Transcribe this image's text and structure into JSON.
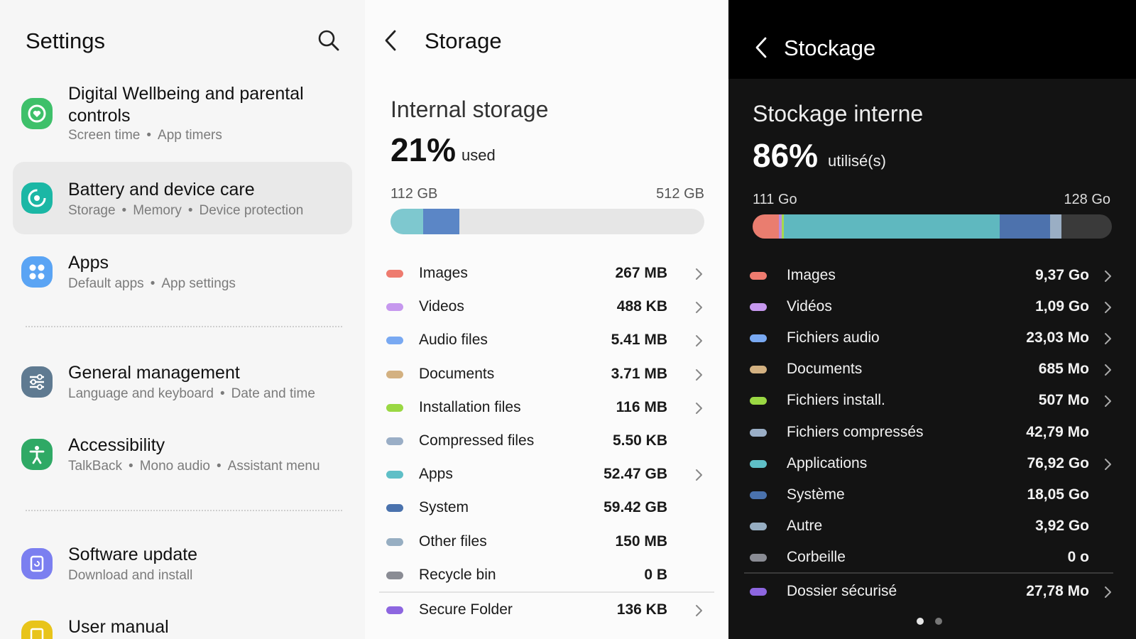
{
  "settings": {
    "title": "Settings",
    "items": [
      {
        "title": "Digital Wellbeing and parental controls",
        "sub": [
          "Screen time",
          "App timers"
        ]
      },
      {
        "title": "Battery and device care",
        "sub": [
          "Storage",
          "Memory",
          "Device protection"
        ]
      },
      {
        "title": "Apps",
        "sub": [
          "Default apps",
          "App settings"
        ]
      },
      {
        "title": "General management",
        "sub": [
          "Language and keyboard",
          "Date and time"
        ]
      },
      {
        "title": "Accessibility",
        "sub": [
          "TalkBack",
          "Mono audio",
          "Assistant menu"
        ]
      },
      {
        "title": "Software update",
        "sub": [
          "Download and install"
        ]
      },
      {
        "title": "User manual",
        "sub": []
      }
    ],
    "colors": {
      "wellbeing": "#3ec06a",
      "battery": "#1bb7a5",
      "apps": "#5aa4f4",
      "general": "#5f7a91",
      "accessibility": "#2fa965",
      "update": "#7b7ff0",
      "manual": "#e8c41a"
    }
  },
  "storage_en": {
    "title": "Storage",
    "heading": "Internal storage",
    "percent": "21%",
    "used_label": "used",
    "used_amount": "112 GB",
    "total": "512 GB",
    "segments": [
      {
        "color": "#7ec8cf",
        "fraction": 0.105
      },
      {
        "color": "#5b86c6",
        "fraction": 0.115
      }
    ],
    "items": [
      {
        "label": "Images",
        "value": "267 MB",
        "color": "#ee7b6f",
        "chevron": true
      },
      {
        "label": "Videos",
        "value": "488 KB",
        "color": "#c698ee",
        "chevron": true
      },
      {
        "label": "Audio files",
        "value": "5.41 MB",
        "color": "#79a9f2",
        "chevron": true
      },
      {
        "label": "Documents",
        "value": "3.71 MB",
        "color": "#d3b181",
        "chevron": true
      },
      {
        "label": "Installation files",
        "value": "116 MB",
        "color": "#9ad843",
        "chevron": true
      },
      {
        "label": "Compressed files",
        "value": "5.50 KB",
        "color": "#9aaec6",
        "chevron": false
      },
      {
        "label": "Apps",
        "value": "52.47 GB",
        "color": "#5fbfc7",
        "chevron": true
      },
      {
        "label": "System",
        "value": "59.42 GB",
        "color": "#4a72ad",
        "chevron": false
      },
      {
        "label": "Other files",
        "value": "150 MB",
        "color": "#97aec2",
        "chevron": false
      },
      {
        "label": "Recycle bin",
        "value": "0 B",
        "color": "#8a8c94",
        "chevron": false
      },
      {
        "label": "Secure Folder",
        "value": "136 KB",
        "color": "#8d66e0",
        "chevron": true
      }
    ]
  },
  "storage_fr": {
    "title": "Stockage",
    "heading": "Stockage interne",
    "percent": "86%",
    "used_label": "utilisé(s)",
    "used_amount": "111 Go",
    "total": "128 Go",
    "segments": [
      {
        "color": "#ea7d6f",
        "fraction": 0.073
      },
      {
        "color": "#b88de0",
        "fraction": 0.009
      },
      {
        "color": "#a7d84e",
        "fraction": 0.004
      },
      {
        "color": "#5fb8bf",
        "fraction": 0.601
      },
      {
        "color": "#4d72ad",
        "fraction": 0.141
      },
      {
        "color": "#9aaec4",
        "fraction": 0.031
      }
    ],
    "items": [
      {
        "label": "Images",
        "value": "9,37 Go",
        "color": "#ee7b6f",
        "chevron": true
      },
      {
        "label": "Vidéos",
        "value": "1,09 Go",
        "color": "#c698ee",
        "chevron": true
      },
      {
        "label": "Fichiers audio",
        "value": "23,03 Mo",
        "color": "#79a9f2",
        "chevron": true
      },
      {
        "label": "Documents",
        "value": "685 Mo",
        "color": "#d3b181",
        "chevron": true
      },
      {
        "label": "Fichiers install.",
        "value": "507 Mo",
        "color": "#9ad843",
        "chevron": true
      },
      {
        "label": "Fichiers compressés",
        "value": "42,79 Mo",
        "color": "#9aaec6",
        "chevron": false
      },
      {
        "label": "Applications",
        "value": "76,92 Go",
        "color": "#5fbfc7",
        "chevron": true
      },
      {
        "label": "Système",
        "value": "18,05 Go",
        "color": "#4a72ad",
        "chevron": false
      },
      {
        "label": "Autre",
        "value": "3,92 Go",
        "color": "#97aec2",
        "chevron": false
      },
      {
        "label": "Corbeille",
        "value": "0 o",
        "color": "#8a8c94",
        "chevron": false
      },
      {
        "label": "Dossier sécurisé",
        "value": "27,78 Mo",
        "color": "#8d66e0",
        "chevron": true
      }
    ]
  }
}
